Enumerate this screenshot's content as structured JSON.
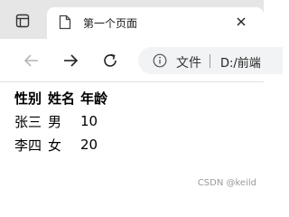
{
  "browser": {
    "tab": {
      "title": "第一个页面",
      "favicon": "page-icon",
      "close_icon": "close-icon"
    },
    "toolbar": {
      "back_icon": "back-arrow-icon",
      "forward_icon": "forward-arrow-icon",
      "reload_icon": "reload-icon",
      "address": {
        "info_icon": "info-icon",
        "info_label": "文件",
        "url": "D:/前端"
      }
    }
  },
  "page": {
    "table": {
      "headers": [
        "性别",
        "姓名",
        "年龄"
      ],
      "rows": [
        [
          "张三",
          "男",
          "10"
        ],
        [
          "李四",
          "女",
          "20"
        ]
      ]
    }
  },
  "watermark": "CSDN @keild"
}
